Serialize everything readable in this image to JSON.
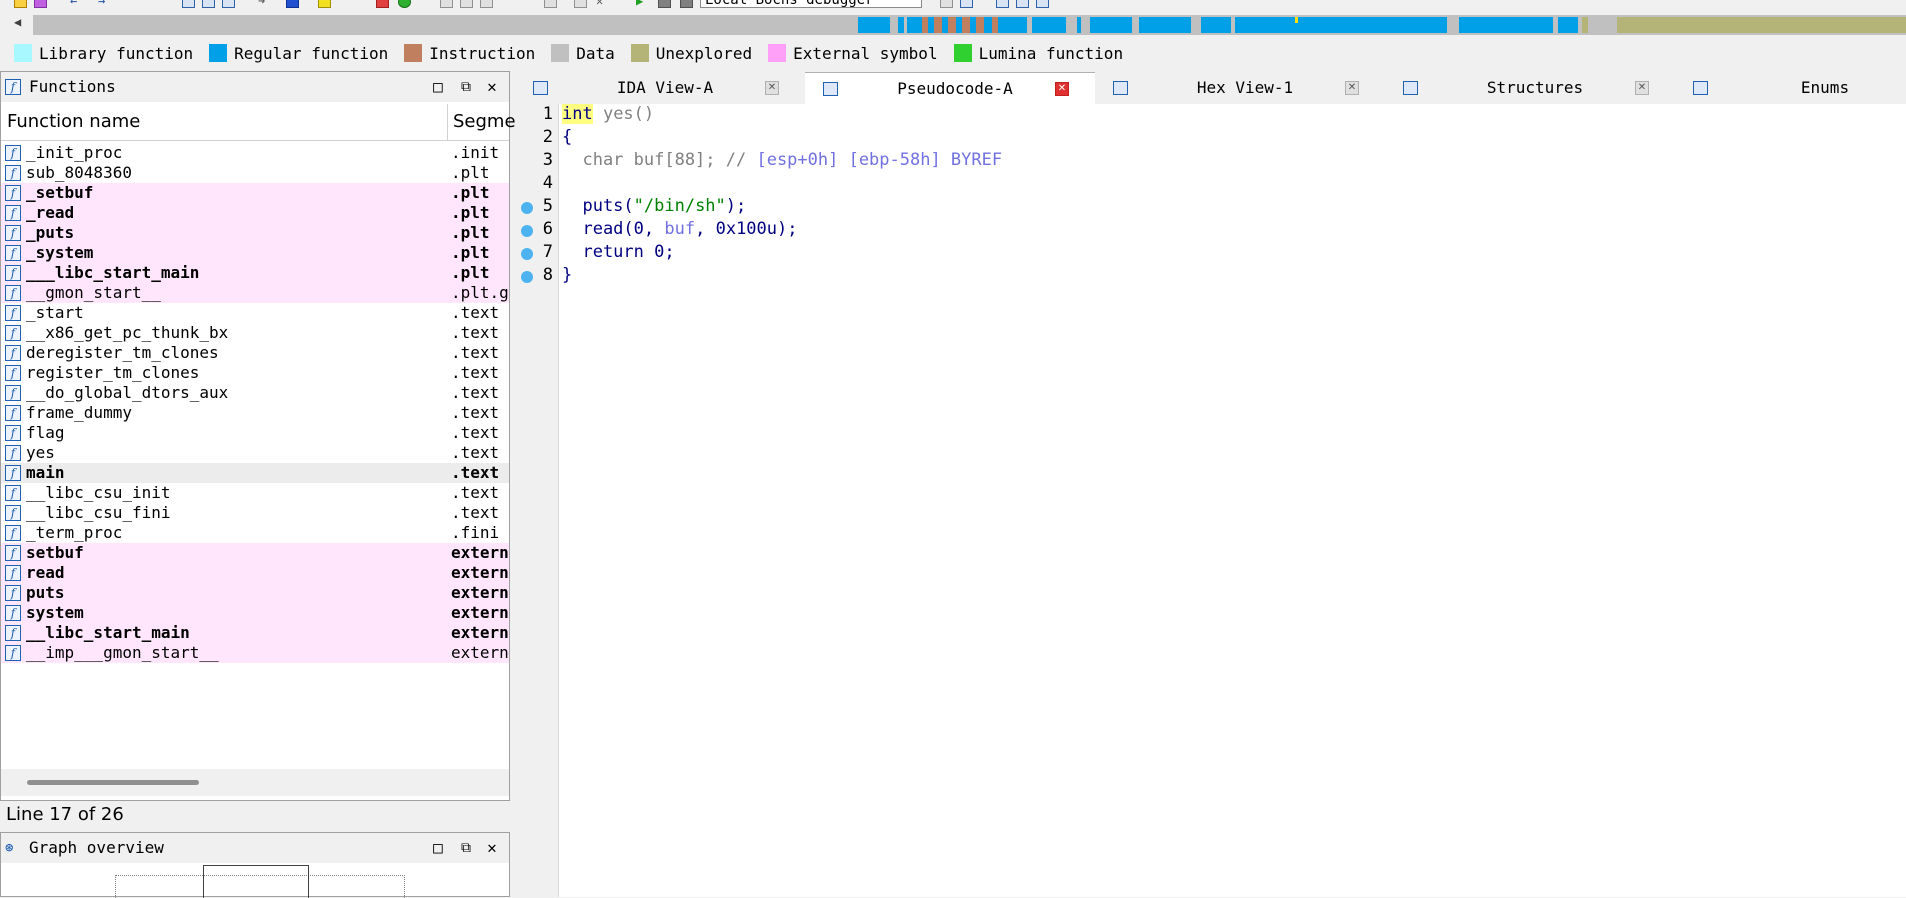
{
  "toolbar": {
    "debugger": "Local Bochs debugger"
  },
  "legend": [
    {
      "label": "Library function",
      "color": "#a8f8ff"
    },
    {
      "label": "Regular function",
      "color": "#00a0e8"
    },
    {
      "label": "Instruction",
      "color": "#c08060"
    },
    {
      "label": "Data",
      "color": "#c0c0c0"
    },
    {
      "label": "Unexplored",
      "color": "#b4b478"
    },
    {
      "label": "External symbol",
      "color": "#ffa0f8"
    },
    {
      "label": "Lumina function",
      "color": "#30d030"
    }
  ],
  "functions_panel": {
    "title": "Functions",
    "col_name": "Function name",
    "col_segment": "Segme",
    "rows": [
      {
        "name": "_init_proc",
        "segment": ".init",
        "style": "normal"
      },
      {
        "name": "sub_8048360",
        "segment": ".plt",
        "style": "normal"
      },
      {
        "name": "_setbuf",
        "segment": ".plt",
        "style": "pink-bold"
      },
      {
        "name": "_read",
        "segment": ".plt",
        "style": "pink-bold"
      },
      {
        "name": "_puts",
        "segment": ".plt",
        "style": "pink-bold"
      },
      {
        "name": "_system",
        "segment": ".plt",
        "style": "pink-bold"
      },
      {
        "name": "___libc_start_main",
        "segment": ".plt",
        "style": "pink-bold"
      },
      {
        "name": "__gmon_start__",
        "segment": ".plt.got",
        "style": "pink"
      },
      {
        "name": "_start",
        "segment": ".text",
        "style": "normal"
      },
      {
        "name": "__x86_get_pc_thunk_bx",
        "segment": ".text",
        "style": "normal"
      },
      {
        "name": "deregister_tm_clones",
        "segment": ".text",
        "style": "normal"
      },
      {
        "name": "register_tm_clones",
        "segment": ".text",
        "style": "normal"
      },
      {
        "name": "__do_global_dtors_aux",
        "segment": ".text",
        "style": "normal"
      },
      {
        "name": "frame_dummy",
        "segment": ".text",
        "style": "normal"
      },
      {
        "name": "flag",
        "segment": ".text",
        "style": "normal"
      },
      {
        "name": "yes",
        "segment": ".text",
        "style": "normal"
      },
      {
        "name": "main",
        "segment": ".text",
        "style": "selected-bold"
      },
      {
        "name": "__libc_csu_init",
        "segment": ".text",
        "style": "normal"
      },
      {
        "name": "__libc_csu_fini",
        "segment": ".text",
        "style": "normal"
      },
      {
        "name": "_term_proc",
        "segment": ".fini",
        "style": "normal"
      },
      {
        "name": "setbuf",
        "segment": "extern",
        "style": "pink-bold"
      },
      {
        "name": "read",
        "segment": "extern",
        "style": "pink-bold"
      },
      {
        "name": "puts",
        "segment": "extern",
        "style": "pink-bold"
      },
      {
        "name": "system",
        "segment": "extern",
        "style": "pink-bold"
      },
      {
        "name": "__libc_start_main",
        "segment": "extern",
        "style": "pink-bold"
      },
      {
        "name": "__imp___gmon_start__",
        "segment": "extern",
        "style": "pink"
      }
    ]
  },
  "status": {
    "line": "Line 17 of 26"
  },
  "graph_panel": {
    "title": "Graph overview"
  },
  "tabs": [
    {
      "label": "IDA View-A",
      "active": false
    },
    {
      "label": "Pseudocode-A",
      "active": true
    },
    {
      "label": "Hex View-1",
      "active": false
    },
    {
      "label": "Structures",
      "active": false
    },
    {
      "label": "Enums",
      "active": false
    }
  ],
  "code": {
    "line_numbers": [
      "1",
      "2",
      "3",
      "4",
      "5",
      "6",
      "7",
      "8"
    ],
    "l1_kw": "int",
    "l1_rest": " yes()",
    "l2": "{",
    "l3_code": "  char buf[88]; //",
    "l3_comment": " [esp+0h] [ebp-58h] BYREF",
    "l5_fn": "  puts(",
    "l5_str": "\"/bin/sh\"",
    "l5_end": ");",
    "l6_a": "  read(",
    "l6_zero": "0",
    "l6_b": ", ",
    "l6_var": "buf",
    "l6_c": ", ",
    "l6_num": "0x100u",
    "l6_end": ");",
    "l7_a": "  return ",
    "l7_num": "0",
    "l7_end": ";",
    "l8": "}"
  }
}
